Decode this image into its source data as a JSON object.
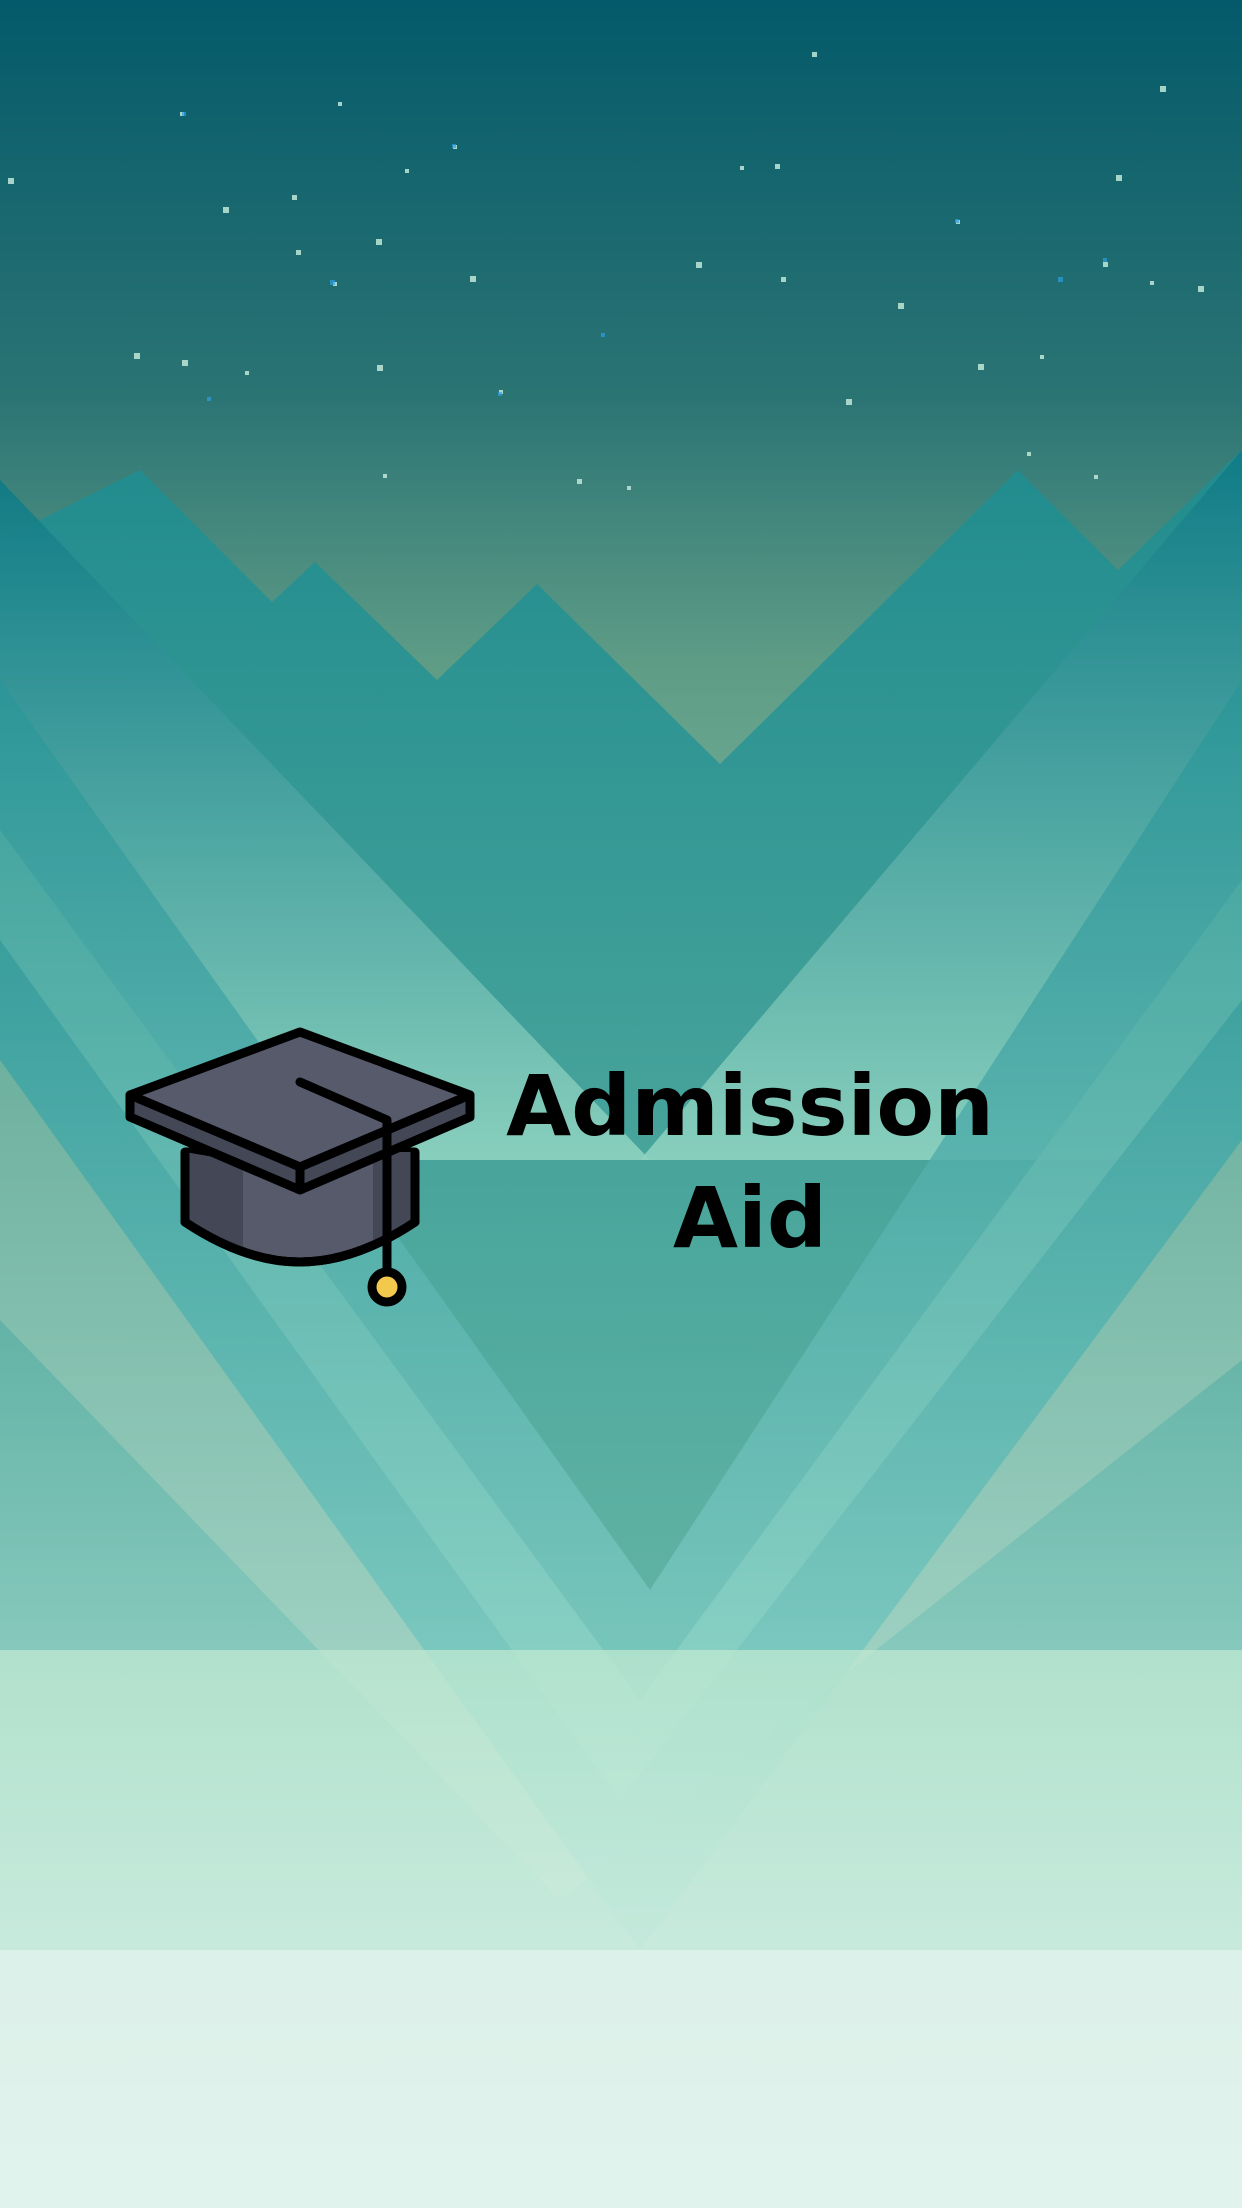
{
  "app": {
    "title_line1": "Admission",
    "title_line2": "Aid"
  },
  "icons": {
    "logo": "graduation-cap-icon"
  },
  "colors": {
    "sky_top": "#045a6a",
    "sky_mid": "#5fa68d",
    "mountain_teal": "#2a9a98",
    "mountain_light": "#a6e4d2",
    "ground_bottom": "#e2f2ec",
    "cap_body": "#565a6b",
    "cap_shadow": "#434756",
    "tassel_bead": "#f2c94c",
    "title_text": "#000000"
  }
}
